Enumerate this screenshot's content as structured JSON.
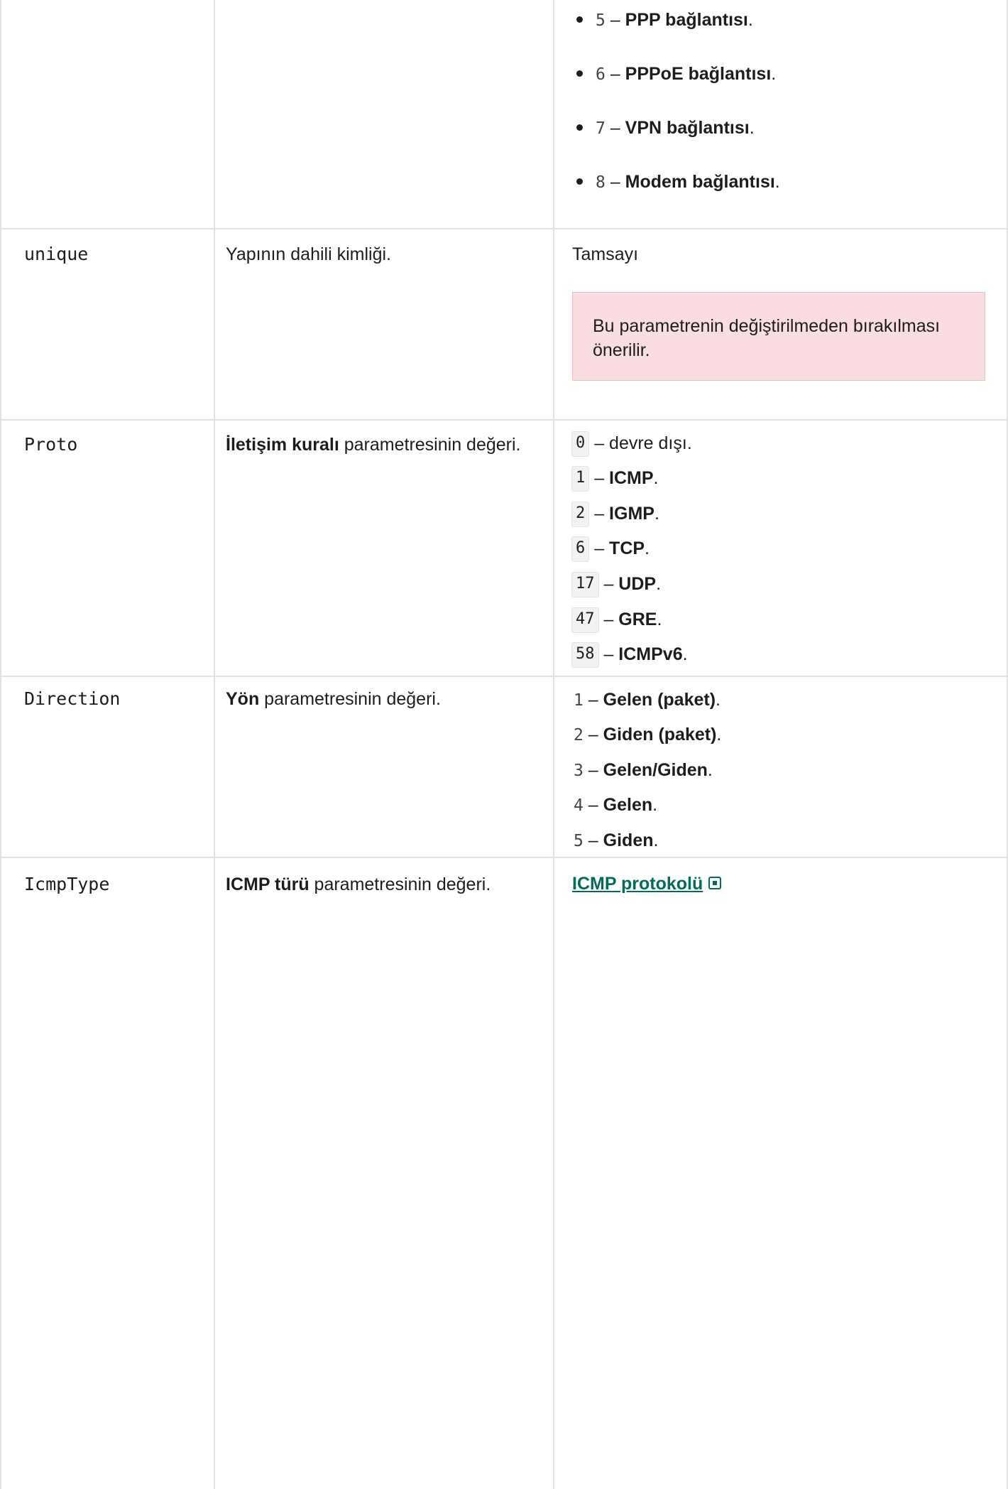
{
  "list_items_top": [
    {
      "num": "5",
      "dash": " – ",
      "label": "PPP bağlantısı",
      "tail": "."
    },
    {
      "num": "6",
      "dash": " – ",
      "label": "PPPoE bağlantısı",
      "tail": "."
    },
    {
      "num": "7",
      "dash": " – ",
      "label": "VPN bağlantısı",
      "tail": "."
    },
    {
      "num": "8",
      "dash": " – ",
      "label": "Modem bağlantısı",
      "tail": "."
    }
  ],
  "rows": {
    "unique": {
      "name": "unique",
      "description": "Yapının dahili kimliği.",
      "type": "Tamsayı",
      "warning": "Bu parametrenin değiştirilmeden bırakılması önerilir."
    },
    "proto": {
      "name": "Proto",
      "description_bold": "İletişim kuralı",
      "description_rest": " parametresinin değeri.",
      "values": [
        {
          "code": "0",
          "dash": " – ",
          "label": "devre dışı",
          "bold": false,
          "tail": "."
        },
        {
          "code": "1",
          "dash": " – ",
          "label": "ICMP",
          "bold": true,
          "tail": "."
        },
        {
          "code": "2",
          "dash": " – ",
          "label": "IGMP",
          "bold": true,
          "tail": "."
        },
        {
          "code": "6",
          "dash": " – ",
          "label": "TCP",
          "bold": true,
          "tail": "."
        },
        {
          "code": "17",
          "dash": " – ",
          "label": "UDP",
          "bold": true,
          "tail": "."
        },
        {
          "code": "47",
          "dash": " – ",
          "label": "GRE",
          "bold": true,
          "tail": "."
        },
        {
          "code": "58",
          "dash": " – ",
          "label": "ICMPv6",
          "bold": true,
          "tail": "."
        }
      ]
    },
    "direction": {
      "name": "Direction",
      "description_bold": "Yön",
      "description_rest": " parametresinin değeri.",
      "values": [
        {
          "num": "1",
          "dash": " – ",
          "label": "Gelen (paket)",
          "tail": "."
        },
        {
          "num": "2",
          "dash": " – ",
          "label": "Giden (paket)",
          "tail": "."
        },
        {
          "num": "3",
          "dash": " – ",
          "label": "Gelen/Giden",
          "tail": "."
        },
        {
          "num": "4",
          "dash": " – ",
          "label": "Gelen",
          "tail": "."
        },
        {
          "num": "5",
          "dash": " – ",
          "label": "Giden",
          "tail": "."
        }
      ]
    },
    "icmptype": {
      "name": "IcmpType",
      "description_bold": "ICMP türü",
      "description_rest": " parametresinin değeri.",
      "link_label": "ICMP protokolü",
      "link_icon": "external-link-icon"
    }
  }
}
